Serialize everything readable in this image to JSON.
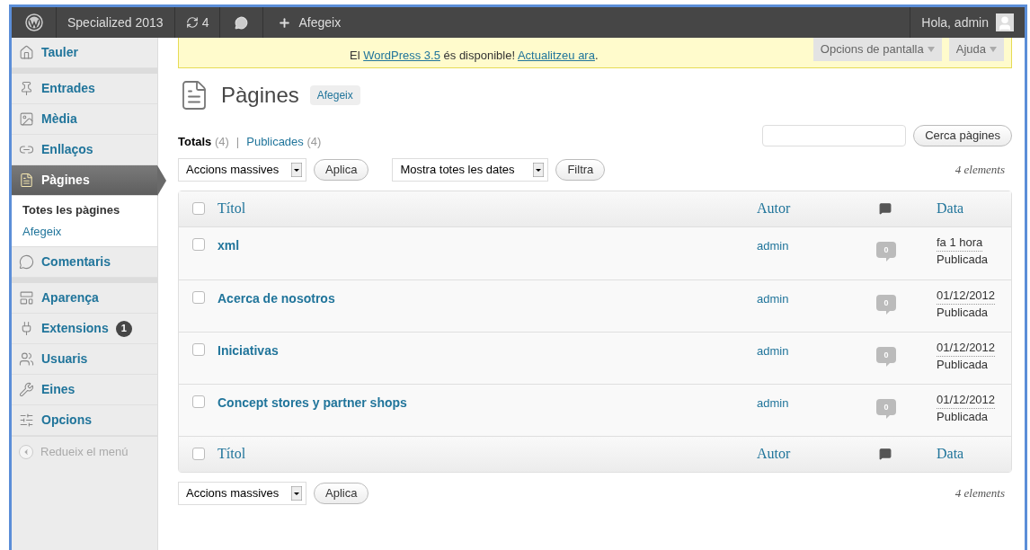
{
  "admin_bar": {
    "site_name": "Specialized 2013",
    "updates_count": "4",
    "new_label": "Afegeix",
    "greeting": "Hola, admin"
  },
  "notice": [
    {
      "kind": "text",
      "text": "El "
    },
    {
      "kind": "link",
      "text": "WordPress 3.5"
    },
    {
      "kind": "text",
      "text": " és disponible! "
    },
    {
      "kind": "link",
      "text": "Actualitzeu ara"
    },
    {
      "kind": "text",
      "text": "."
    }
  ],
  "screen_tabs": [
    "Opcions de pantalla",
    "Ajuda"
  ],
  "sidebar": {
    "groups": [
      [
        {
          "label": "Tauler",
          "selected": false
        }
      ],
      [
        {
          "label": "Entrades",
          "selected": false
        },
        {
          "label": "Mèdia",
          "selected": false
        },
        {
          "label": "Enllaços",
          "selected": false
        },
        {
          "label": "Pàgines",
          "selected": true,
          "children": [
            {
              "label": "Totes les pàgines",
              "selected": true
            },
            {
              "label": "Afegeix",
              "selected": false
            }
          ]
        },
        {
          "label": "Comentaris",
          "selected": false
        }
      ],
      [
        {
          "label": "Aparença",
          "selected": false
        },
        {
          "label": "Extensions",
          "selected": false,
          "badge": "1"
        },
        {
          "label": "Usuaris",
          "selected": false
        },
        {
          "label": "Eines",
          "selected": false
        },
        {
          "label": "Opcions",
          "selected": false
        }
      ]
    ],
    "collapse_label": "Redueix el menú"
  },
  "page": {
    "title": "Pàgines",
    "add_button": "Afegeix"
  },
  "views": [
    {
      "label": "Totals",
      "count": "(4)",
      "selected": true
    },
    {
      "label": "Publicades",
      "count": "(4)",
      "selected": false
    }
  ],
  "views_separator": "|",
  "search": {
    "button": "Cerca pàgines"
  },
  "top_actions": {
    "bulk_select": "Accions massives",
    "apply": "Aplica",
    "date_select": "Mostra totes les dates",
    "filter": "Filtra",
    "count": "4 elements"
  },
  "table": {
    "columns": [
      {
        "kind": "title",
        "label": "Títol"
      },
      {
        "kind": "author",
        "label": "Autor"
      },
      {
        "kind": "comments"
      },
      {
        "kind": "date",
        "label": "Data"
      }
    ],
    "footer_columns": [
      {
        "kind": "title",
        "label": "Títol"
      },
      {
        "kind": "author",
        "label": "Autor"
      },
      {
        "kind": "comments"
      },
      {
        "kind": "date",
        "label": "Data"
      }
    ],
    "header_checked": false,
    "footer_checked": false,
    "rows": [
      {
        "title": "xml",
        "author": "admin",
        "comments": "0",
        "date": "fa 1 hora",
        "status": "Publicada",
        "checked": false
      },
      {
        "title": "Acerca de nosotros",
        "author": "admin",
        "comments": "0",
        "date": "01/12/2012",
        "status": "Publicada",
        "checked": false
      },
      {
        "title": "Iniciativas",
        "author": "admin",
        "comments": "0",
        "date": "01/12/2012",
        "status": "Publicada",
        "checked": false
      },
      {
        "title": "Concept stores y partner shops",
        "author": "admin",
        "comments": "0",
        "date": "01/12/2012",
        "status": "Publicada",
        "checked": false
      }
    ]
  },
  "bottom_actions": {
    "bulk_select": "Accions massives",
    "apply": "Aplica",
    "count": "4 elements"
  }
}
